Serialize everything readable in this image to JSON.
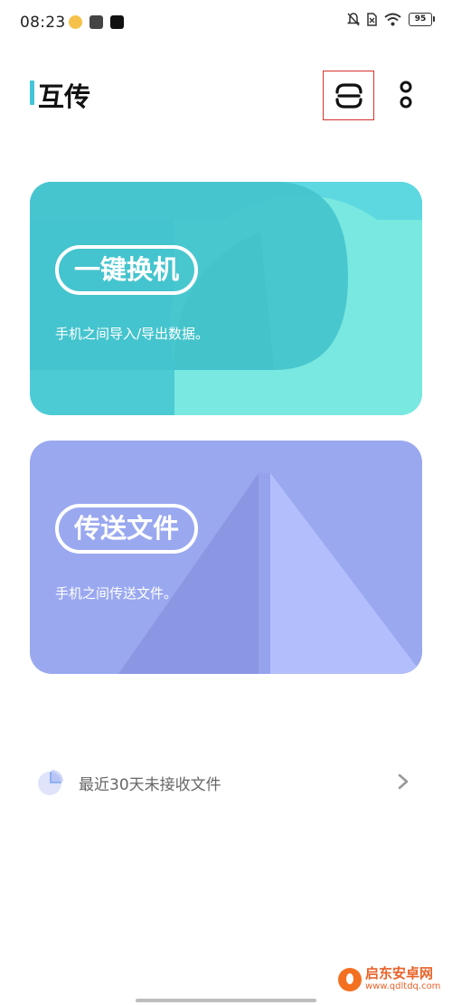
{
  "status_bar": {
    "time": "08:23",
    "battery_level": "95",
    "icons": [
      "weibo-icon",
      "mail-icon",
      "tiktok-icon",
      "mute-icon",
      "sim-off-icon",
      "wifi-icon",
      "battery-icon"
    ]
  },
  "header": {
    "title": "互传",
    "accent_color": "#44c6d6",
    "scan_icon": "scan-icon",
    "more_icon": "more-icon"
  },
  "cards": {
    "switch": {
      "label": "一键换机",
      "description": "手机之间导入/导出数据。",
      "colors": [
        "#4ccdd5",
        "#78e8e0"
      ]
    },
    "send": {
      "label": "传送文件",
      "description": "手机之间传送文件。",
      "colors": [
        "#9aa8f0",
        "#b4c0ff"
      ]
    }
  },
  "recent": {
    "label": "最近30天未接收文件",
    "icon": "pie-chart-icon",
    "chevron": "chevron-right-icon"
  },
  "watermark": {
    "title": "启东安卓网",
    "url": "www.qdltdq.com"
  }
}
